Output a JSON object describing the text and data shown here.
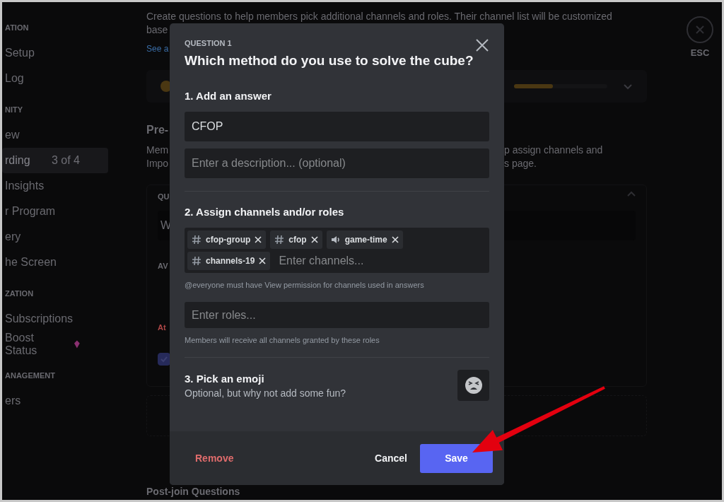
{
  "sidebar": {
    "sections": [
      {
        "header": "ATION",
        "items": [
          {
            "label": "Setup",
            "selected": false
          },
          {
            "label": "Log",
            "selected": false
          }
        ]
      },
      {
        "header": "NITY",
        "items": [
          {
            "label": "ew",
            "selected": false
          },
          {
            "label": "rding",
            "badge": "3 of 4",
            "selected": true
          },
          {
            "label": "Insights",
            "selected": false
          },
          {
            "label": "r Program",
            "selected": false
          },
          {
            "label": "ery",
            "selected": false
          },
          {
            "label": "he Screen",
            "selected": false
          }
        ]
      },
      {
        "header": "ZATION",
        "items": [
          {
            "label": "Subscriptions",
            "selected": false
          },
          {
            "label": "Boost Status",
            "boost_icon": true,
            "selected": false
          }
        ]
      },
      {
        "header": "ANAGEMENT",
        "items": [
          {
            "label": "ers",
            "selected": false
          }
        ]
      }
    ]
  },
  "main": {
    "intro": "Create questions to help members pick additional channels and roles. Their channel list will be customized",
    "intro_cont": "base",
    "link": "See a",
    "progress": {
      "level": 0.42
    },
    "prejoin": {
      "title": "Pre-",
      "desc_left": [
        "Mem",
        "Impo"
      ],
      "desc_right": [
        "p assign channels and",
        "s page."
      ]
    },
    "question_card": {
      "label": "QU",
      "value": "W",
      "answers_label": "AV",
      "alert": "At",
      "checked": true
    },
    "post_join": "Post-join Questions"
  },
  "esc": "ESC",
  "modal": {
    "eyebrow": "QUESTION 1",
    "title": "Which method do you use to solve the cube?",
    "answer": {
      "heading": "1. Add an answer",
      "value": "CFOP",
      "description_placeholder": "Enter a description... (optional)"
    },
    "assign": {
      "heading": "2. Assign channels and/or roles",
      "tags": [
        {
          "label": "cfop-group",
          "kind": "text"
        },
        {
          "label": "cfop",
          "kind": "text"
        },
        {
          "label": "game-time",
          "kind": "voice"
        },
        {
          "label": "channels-19",
          "kind": "text"
        }
      ],
      "channels_placeholder": "Enter channels...",
      "channels_hint": "@everyone must have View permission for channels used in answers",
      "roles_placeholder": "Enter roles...",
      "roles_hint": "Members will receive all channels granted by these roles"
    },
    "emoji": {
      "heading": "3. Pick an emoji",
      "subtitle": "Optional, but why not add some fun?"
    },
    "buttons": {
      "remove": "Remove",
      "cancel": "Cancel",
      "save": "Save"
    }
  }
}
